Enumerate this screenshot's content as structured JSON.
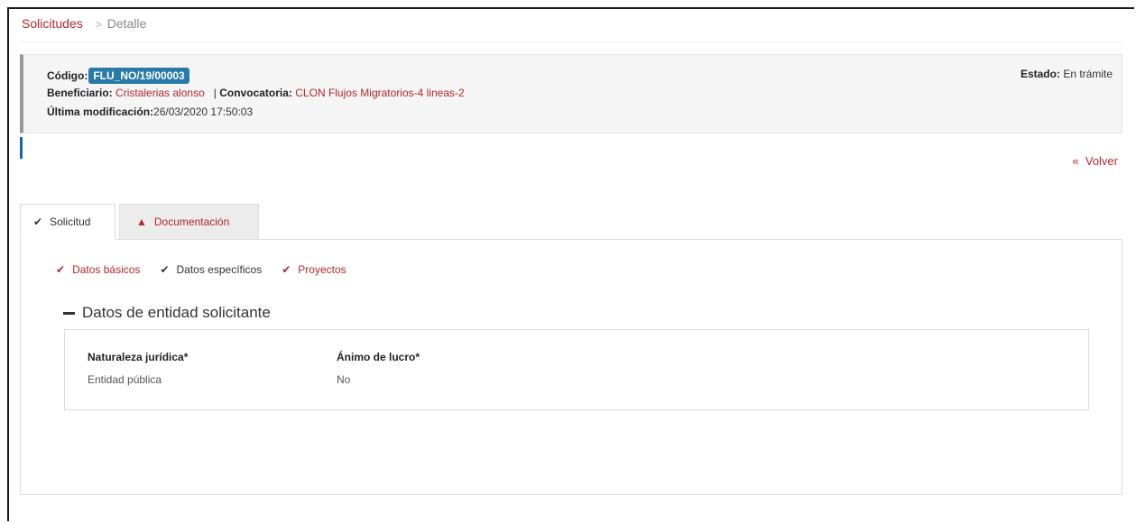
{
  "breadcrumb": {
    "link": "Solicitudes",
    "separator": ">",
    "current": "Detalle"
  },
  "header": {
    "code_label": "Código:",
    "code_value": "FLU_NO/19/00003",
    "beneficiary_label": "Beneficiario:",
    "beneficiary_value": "Cristalerias alonso",
    "pipe": "|",
    "call_label": "Convocatoria:",
    "call_value": "CLON Flujos Migratorios-4 lineas-2",
    "modified_label": "Última modificación:",
    "modified_value": "26/03/2020 17:50:03",
    "status_label": "Estado:",
    "status_value": "En trámite"
  },
  "actions": {
    "back_icon": "«",
    "back_label": "Volver"
  },
  "tabs": [
    {
      "label": "Solicitud",
      "icon": "check-icon",
      "active": true
    },
    {
      "label": "Documentación",
      "icon": "warning-icon",
      "active": false
    }
  ],
  "subnav": [
    {
      "label": "Datos básicos",
      "icon": "check-icon",
      "color": "#b5262b"
    },
    {
      "label": "Datos específicos",
      "icon": "check-icon",
      "color": "#333333"
    },
    {
      "label": "Proyectos",
      "icon": "check-icon",
      "color": "#b5262b"
    }
  ],
  "section": {
    "title": "Datos de entidad solicitante",
    "fields": [
      {
        "label": "Naturaleza jurídica*",
        "value": "Entidad pública"
      },
      {
        "label": "Ánimo de lucro*",
        "value": "No"
      }
    ]
  },
  "colors": {
    "accent_red": "#b5262b",
    "badge_blue": "#2a7aa8",
    "marker_blue": "#1467a9"
  }
}
